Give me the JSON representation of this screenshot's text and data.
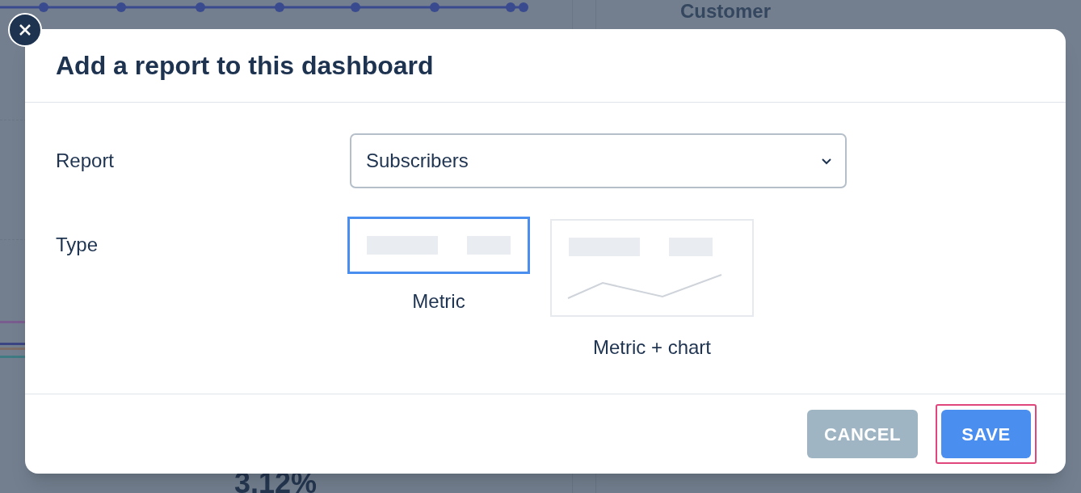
{
  "background": {
    "column_header": "Customer",
    "stats": [
      "3.12%"
    ]
  },
  "dialog": {
    "title": "Add a report to this dashboard",
    "fields": [
      {
        "label": "Report",
        "value": "Subscribers"
      }
    ],
    "type_label": "Type",
    "types": [
      {
        "label": "Metric",
        "kind": "metric",
        "selected": true
      },
      {
        "label": "Metric + chart",
        "kind": "metric_chart",
        "selected": false
      }
    ],
    "buttons": [
      {
        "label": "CANCEL",
        "kind": "secondary",
        "focused": false
      },
      {
        "label": "SAVE",
        "kind": "primary",
        "focused": true
      }
    ]
  }
}
